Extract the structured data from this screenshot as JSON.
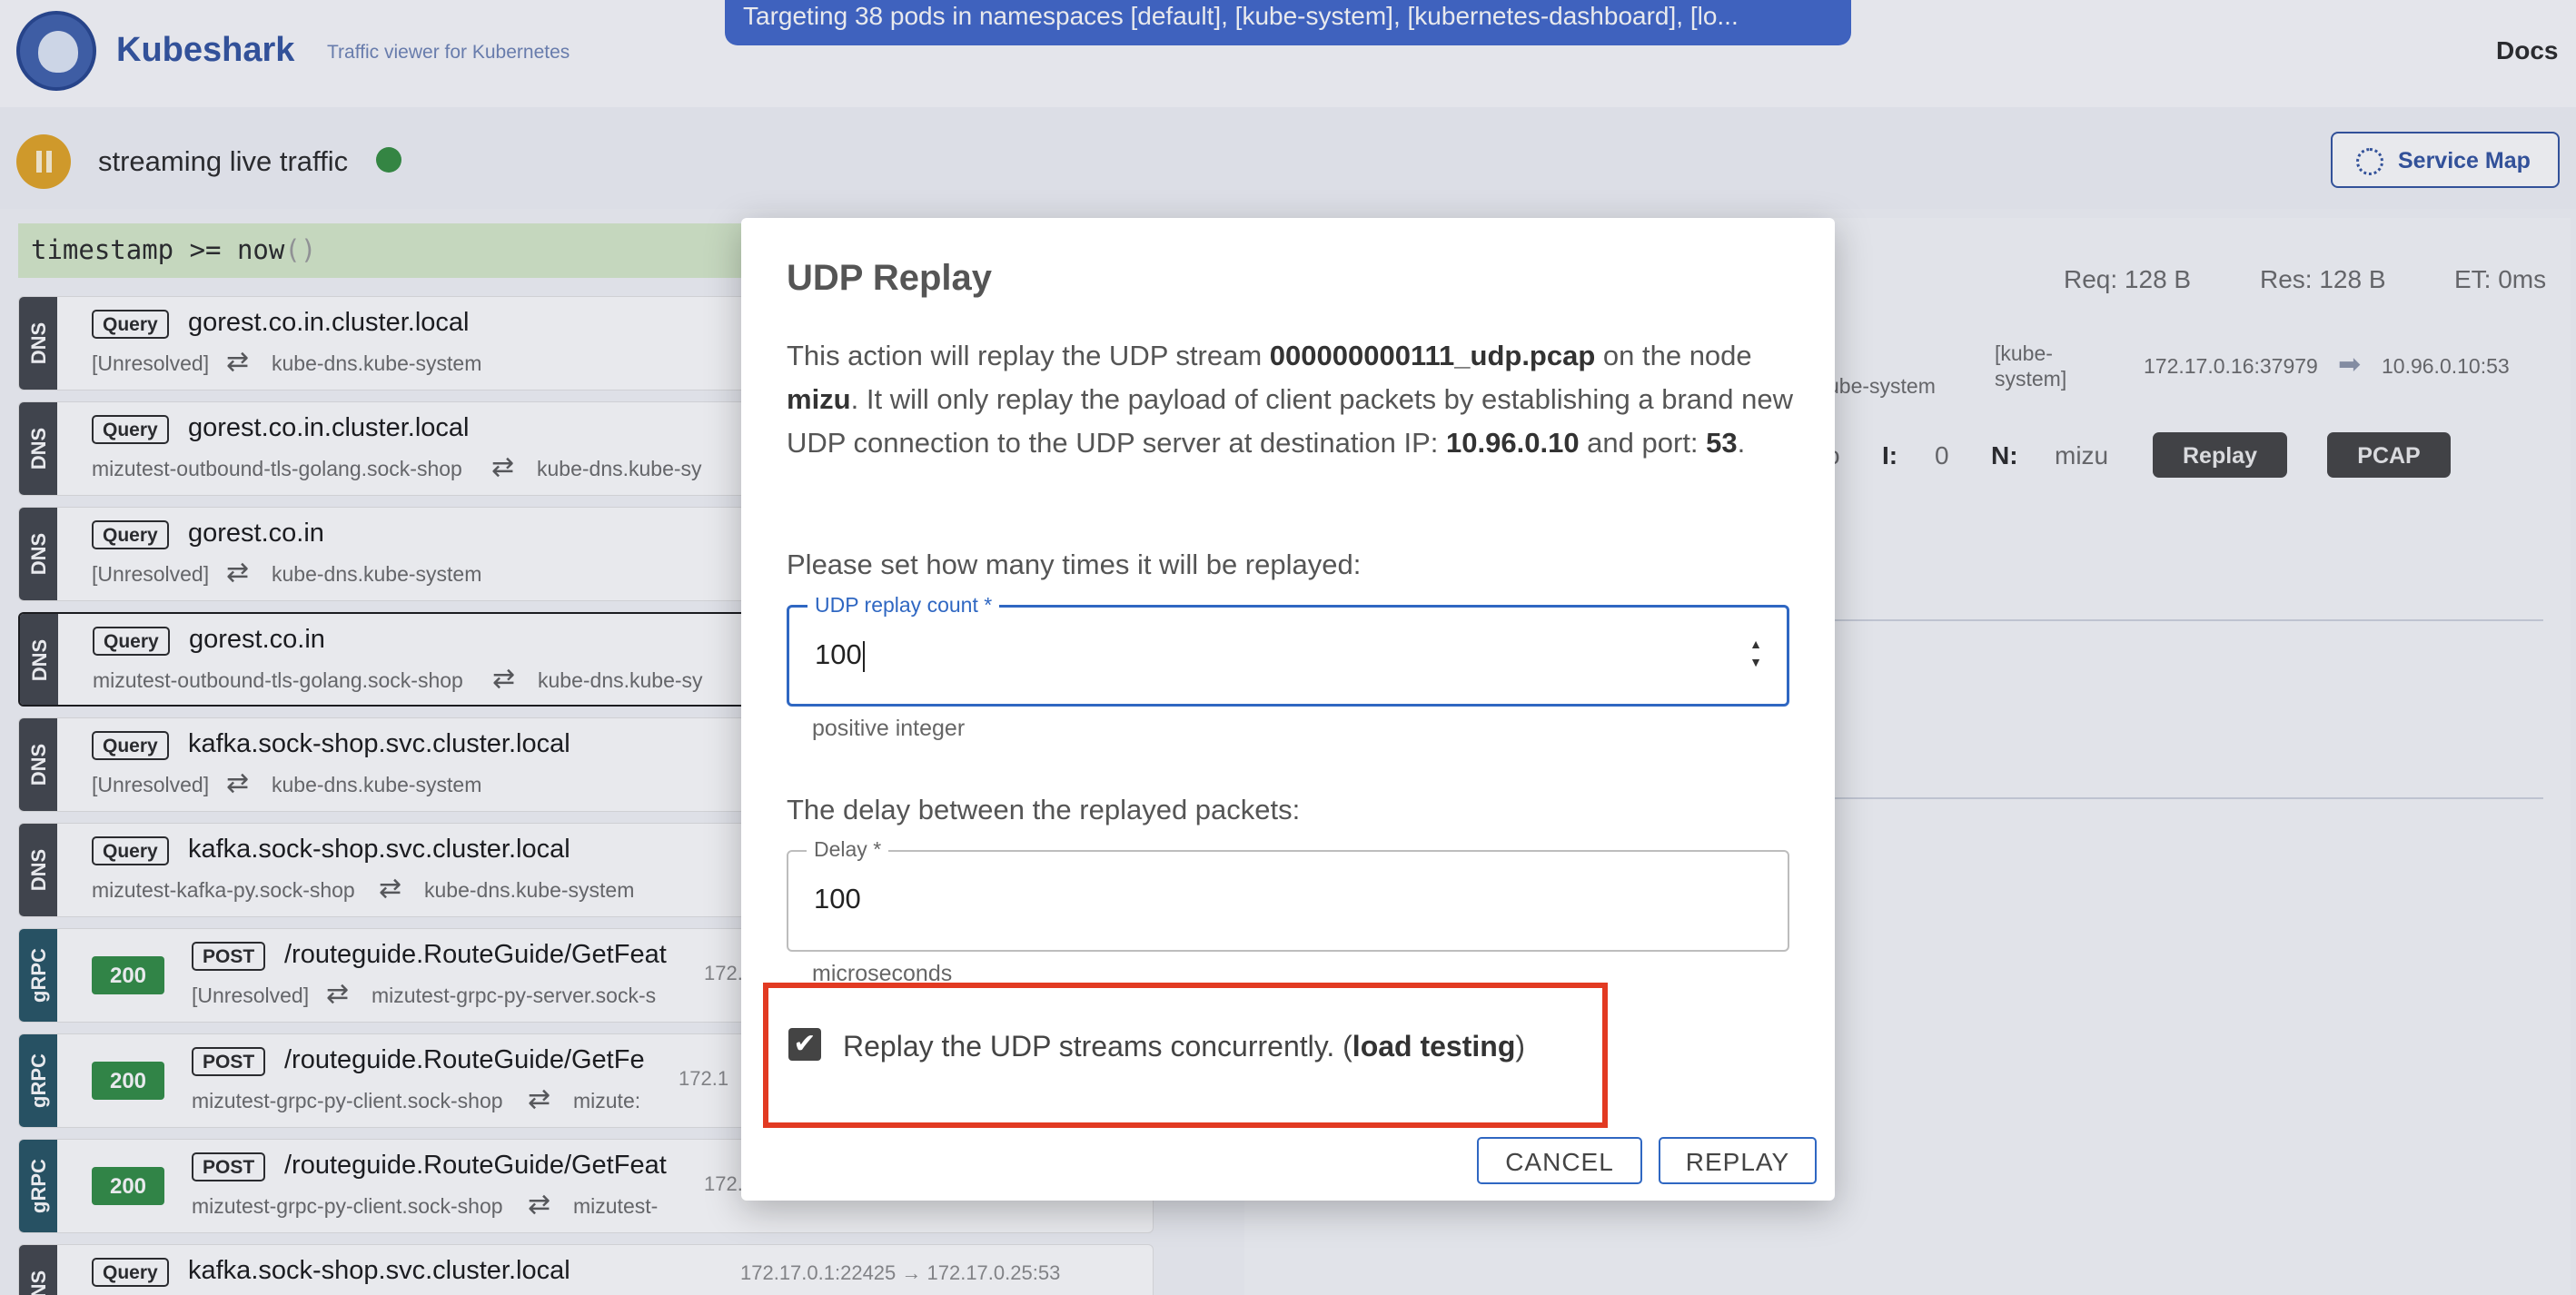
{
  "header": {
    "brand": "Kubeshark",
    "tagline": "Traffic viewer for Kubernetes",
    "banner": "Targeting 38 pods in namespaces [default], [kube-system], [kubernetes-dashboard], [lo...",
    "docs": "Docs",
    "streaming_label": "streaming live traffic",
    "service_map_label": "Service Map"
  },
  "query": {
    "text": "timestamp >= now",
    "parens": "()"
  },
  "entries": [
    {
      "protocol": "DNS",
      "method": "Query",
      "summary": "gorest.co.in.cluster.local",
      "src": "[Unresolved]",
      "dst": "kube-dns.kube-system"
    },
    {
      "protocol": "DNS",
      "method": "Query",
      "summary": "gorest.co.in.cluster.local",
      "src": "mizutest-outbound-tls-golang.sock-shop",
      "dst": "kube-dns.kube-sy"
    },
    {
      "protocol": "DNS",
      "method": "Query",
      "summary": "gorest.co.in",
      "src": "[Unresolved]",
      "dst": "kube-dns.kube-system"
    },
    {
      "protocol": "DNS",
      "method": "Query",
      "summary": "gorest.co.in",
      "src": "mizutest-outbound-tls-golang.sock-shop",
      "dst": "kube-dns.kube-sy"
    },
    {
      "protocol": "DNS",
      "method": "Query",
      "summary": "kafka.sock-shop.svc.cluster.local",
      "src": "[Unresolved]",
      "dst": "kube-dns.kube-system"
    },
    {
      "protocol": "DNS",
      "method": "Query",
      "summary": "kafka.sock-shop.svc.cluster.local",
      "src": "mizutest-kafka-py.sock-shop",
      "dst": "kube-dns.kube-system"
    },
    {
      "protocol": "gRPC",
      "status": "200",
      "method": "POST",
      "summary": "/routeguide.RouteGuide/GetFeat",
      "src": "[Unresolved]",
      "dst": "mizutest-grpc-py-server.sock-s",
      "ip": "172."
    },
    {
      "protocol": "gRPC",
      "status": "200",
      "method": "POST",
      "summary": "/routeguide.RouteGuide/GetFe",
      "src": "mizutest-grpc-py-client.sock-shop",
      "dst": "mizute:",
      "ip": "172.1"
    },
    {
      "protocol": "gRPC",
      "status": "200",
      "method": "POST",
      "summary": "/routeguide.RouteGuide/GetFeat",
      "src": "mizutest-grpc-py-client.sock-shop",
      "dst": "mizutest-",
      "ip": "172."
    },
    {
      "protocol": "DNS",
      "method": "Query",
      "summary": "kafka.sock-shop.svc.cluster.local",
      "src": "",
      "dst": "",
      "ip": "172.17.0.1:22425 → 172.17.0.25:53"
    }
  ],
  "detail": {
    "req": "Req: 128 B",
    "res": "Res: 128 B",
    "et": "ET: 0ms",
    "src_ns": "ube-system",
    "ns_bracket": "[kube-",
    "ns_bracket2": "system]",
    "src_ip": "172.17.0.16:37979",
    "dst_ip": "10.96.0.10:53",
    "frag": "o",
    "i_label": "I:",
    "i_value": "0",
    "n_label": "N:",
    "n_value": "mizu",
    "replay_label": "Replay",
    "pcap_label": "PCAP"
  },
  "modal": {
    "title": "UDP Replay",
    "desc_1": "This action will replay the UDP stream ",
    "stream_file": "000000000111_udp.pcap",
    "desc_2": " on the node ",
    "node": "mizu",
    "desc_3": ". It will only replay the payload of client packets by establishing a brand new UDP connection to the UDP server at destination IP: ",
    "dest_ip": "10.96.0.10",
    "desc_4": " and port: ",
    "port": "53",
    "desc_5": ".",
    "count_prompt": "Please set how many times it will be replayed:",
    "count_label": "UDP replay count",
    "count_required": "*",
    "count_value": "100",
    "count_helper": "positive integer",
    "delay_prompt": "The delay between the replayed packets:",
    "delay_label": "Delay",
    "delay_required": "*",
    "delay_value": "100",
    "delay_helper": "microseconds",
    "concurrent_checked": true,
    "concurrent_text_1": "Replay the UDP streams concurrently. (",
    "concurrent_bold": "load testing",
    "concurrent_text_2": ")",
    "cancel_label": "CANCEL",
    "replay_label": "REPLAY"
  },
  "colors": {
    "brand": "#2c4e9e",
    "banner": "#3b62c9",
    "status_ok": "#2b8a3e",
    "focus": "#2f67c2",
    "highlight": "#e23a22"
  }
}
